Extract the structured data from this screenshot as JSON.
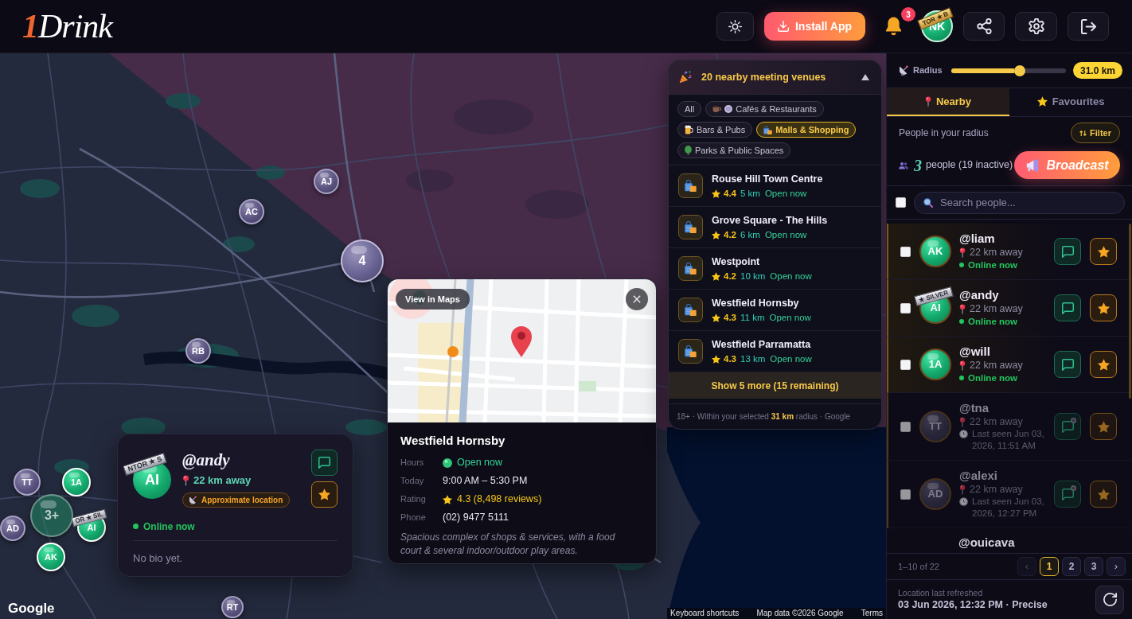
{
  "header": {
    "logo": {
      "numeral": "1",
      "word": "Drink"
    },
    "install_button": "Install App",
    "notification_count": "3",
    "profile": {
      "initials": "NK",
      "ribbon": {
        "text": "TOR ★ B",
        "kind": "gold"
      }
    }
  },
  "map": {
    "markers": [
      {
        "label": "AJ",
        "kind": "person",
        "online": false
      },
      {
        "label": "AC",
        "kind": "person",
        "online": false
      },
      {
        "label": "4",
        "kind": "cluster",
        "online": false
      },
      {
        "label": "RB",
        "kind": "person",
        "online": false
      },
      {
        "label": "TT",
        "kind": "person",
        "online": false
      },
      {
        "label": "1A",
        "kind": "person",
        "online": true
      },
      {
        "label": "3+",
        "kind": "cluster",
        "online": true
      },
      {
        "label": "AD",
        "kind": "person",
        "online": false
      },
      {
        "label": "AI",
        "kind": "person",
        "online": true,
        "ribbon": {
          "text": "OR ★ SIL",
          "kind": "silver"
        }
      },
      {
        "label": "AK",
        "kind": "person",
        "online": true
      },
      {
        "label": "RT",
        "kind": "person",
        "online": false
      }
    ],
    "user_card": {
      "initials": "AI",
      "ribbon": {
        "text": "NTOR ★ S",
        "kind": "silver"
      },
      "username": "@andy",
      "distance": "22 km away",
      "location_badge": "Approximate location",
      "online": true,
      "status": "Online now",
      "bio": "No bio yet."
    },
    "place_popup": {
      "view_in_maps": "View in Maps",
      "name": "Westfield Hornsby",
      "details": [
        {
          "label": "Hours",
          "value": "Open now",
          "kind": "status"
        },
        {
          "label": "Today",
          "value": "9:00 AM – 5:30 PM",
          "kind": "text"
        },
        {
          "label": "Rating",
          "value": "4.3 (8,498 reviews)",
          "kind": "rating"
        },
        {
          "label": "Phone",
          "value": "(02) 9477 5111",
          "kind": "text"
        }
      ],
      "description": "Spacious complex of shops & services, with a food court & several indoor/outdoor play areas."
    },
    "venues_panel": {
      "title": "20 nearby meeting venues",
      "expanded": true,
      "filters": [
        {
          "label": "All",
          "kind": "all",
          "selected": false
        },
        {
          "label": "Cafés & Restaurants",
          "kind": "cafes",
          "selected": false
        },
        {
          "label": "Bars & Pubs",
          "kind": "bars",
          "selected": false
        },
        {
          "label": "Malls & Shopping",
          "kind": "malls",
          "selected": true
        },
        {
          "label": "Parks & Public Spaces",
          "kind": "parks",
          "selected": false
        }
      ],
      "venues": [
        {
          "name": "Rouse Hill Town Centre",
          "rating": "4.4",
          "distance": "5 km",
          "status": "Open now"
        },
        {
          "name": "Grove Square - The Hills",
          "rating": "4.2",
          "distance": "6 km",
          "status": "Open now"
        },
        {
          "name": "Westpoint",
          "rating": "4.2",
          "distance": "10 km",
          "status": "Open now"
        },
        {
          "name": "Westfield Hornsby",
          "rating": "4.3",
          "distance": "11 km",
          "status": "Open now"
        },
        {
          "name": "Westfield Parramatta",
          "rating": "4.3",
          "distance": "13 km",
          "status": "Open now"
        }
      ],
      "show_more": "Show 5 more (15 remaining)",
      "footer": "18+ · Within your selected **31 km** radius · Google"
    },
    "google_logo": "Google",
    "attribution": [
      "Keyboard shortcuts",
      "Map data ©2026 Google",
      "Terms"
    ]
  },
  "sidebar": {
    "radius": {
      "label": "Radius",
      "level": 0.6,
      "value": "31.0 km"
    },
    "tabs": [
      {
        "label": "Nearby",
        "selected": true
      },
      {
        "label": "Favourites",
        "selected": false
      }
    ],
    "heading": "People in your radius",
    "filter_button": "Filter",
    "count": {
      "number": "3",
      "label": "people (19 inactive)"
    },
    "broadcast_button": "Broadcast",
    "select_all": {
      "checked": false
    },
    "search": {
      "placeholder": "Search people..."
    },
    "people": [
      {
        "username": "@liam",
        "initials": "AK",
        "distance": "22 km away",
        "online": true,
        "status": "Online now",
        "checked": false
      },
      {
        "username": "@andy",
        "initials": "AI",
        "ribbon": {
          "text": "★ SILVER",
          "kind": "silver"
        },
        "distance": "22 km away",
        "online": true,
        "status": "Online now",
        "checked": false
      },
      {
        "username": "@will",
        "initials": "1A",
        "distance": "22 km away",
        "online": true,
        "status": "Online now",
        "checked": false
      },
      {
        "username": "@tna",
        "initials": "TT",
        "distance": "22 km away",
        "online": false,
        "status": "Last seen Jun 03, 2026, 11:51 AM",
        "checked": false
      },
      {
        "username": "@alexi",
        "initials": "AD",
        "distance": "22 km away",
        "online": false,
        "status": "Last seen Jun 03, 2026, 12:27 PM",
        "checked": false
      },
      {
        "username": "@ouicava"
      }
    ],
    "pagination": {
      "range": "1–10 of 22",
      "prev": {
        "label": "‹",
        "disabled": true
      },
      "pages": [
        {
          "label": "1",
          "selected": true
        },
        {
          "label": "2",
          "selected": false
        },
        {
          "label": "3",
          "selected": false
        }
      ],
      "next": {
        "label": "›",
        "disabled": false
      }
    },
    "footer": {
      "label": "Location last refreshed",
      "value": "03 Jun 2026, 12:32 PM · Precise"
    }
  }
}
